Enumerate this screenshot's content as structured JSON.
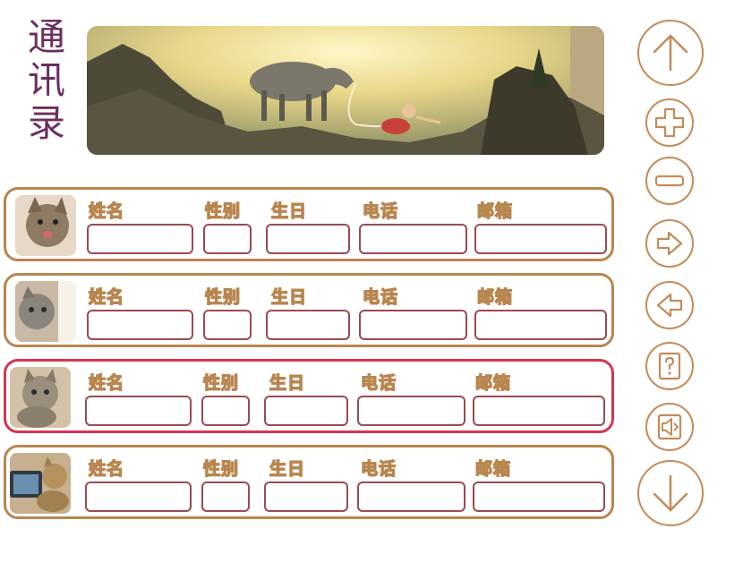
{
  "title": [
    "通",
    "讯",
    "录"
  ],
  "labels": {
    "name": "姓名",
    "gender": "性别",
    "birthday": "生日",
    "phone": "电话",
    "email": "邮箱"
  },
  "contacts": [
    {
      "name": "",
      "gender": "",
      "birthday": "",
      "phone": "",
      "email": "",
      "active": false
    },
    {
      "name": "",
      "gender": "",
      "birthday": "",
      "phone": "",
      "email": "",
      "active": false
    },
    {
      "name": "",
      "gender": "",
      "birthday": "",
      "phone": "",
      "email": "",
      "active": true
    },
    {
      "name": "",
      "gender": "",
      "birthday": "",
      "phone": "",
      "email": "",
      "active": false
    }
  ],
  "colors": {
    "title": "#6b2f5e",
    "card_border": "#b8864f",
    "card_active_border": "#d9344f",
    "field_border": "#9b4a52",
    "nav_stroke": "#c48a58"
  },
  "nav_icons": [
    "arrow-up-icon",
    "plus-icon",
    "minus-icon",
    "arrow-right-icon",
    "arrow-left-icon",
    "help-icon",
    "sound-icon",
    "arrow-down-icon"
  ]
}
